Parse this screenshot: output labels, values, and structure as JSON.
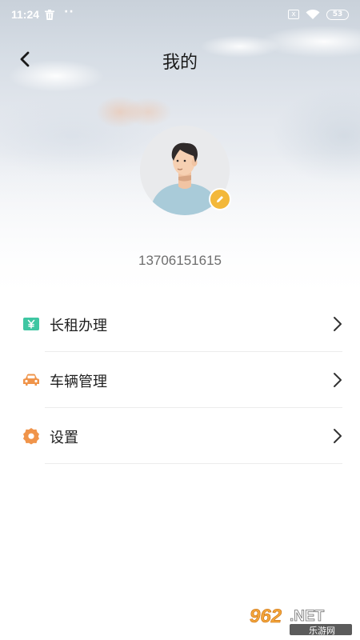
{
  "status_bar": {
    "time": "11:24",
    "dots": "··",
    "sim_label": "x",
    "battery": "53"
  },
  "header": {
    "title": "我的"
  },
  "profile": {
    "phone": "13706151615"
  },
  "menu": {
    "items": [
      {
        "label": "长租办理",
        "icon": "yen-card-icon",
        "icon_color": "#3ec6a2"
      },
      {
        "label": "车辆管理",
        "icon": "car-icon",
        "icon_color": "#f0944a"
      },
      {
        "label": "设置",
        "icon": "gear-icon",
        "icon_color": "#f0944a"
      }
    ]
  },
  "colors": {
    "edit_badge": "#f3b83a",
    "title_text": "#1a1a1a",
    "phone_text": "#6e6e6e"
  },
  "watermark": {
    "main": "962.NET",
    "sub": "乐游网"
  }
}
